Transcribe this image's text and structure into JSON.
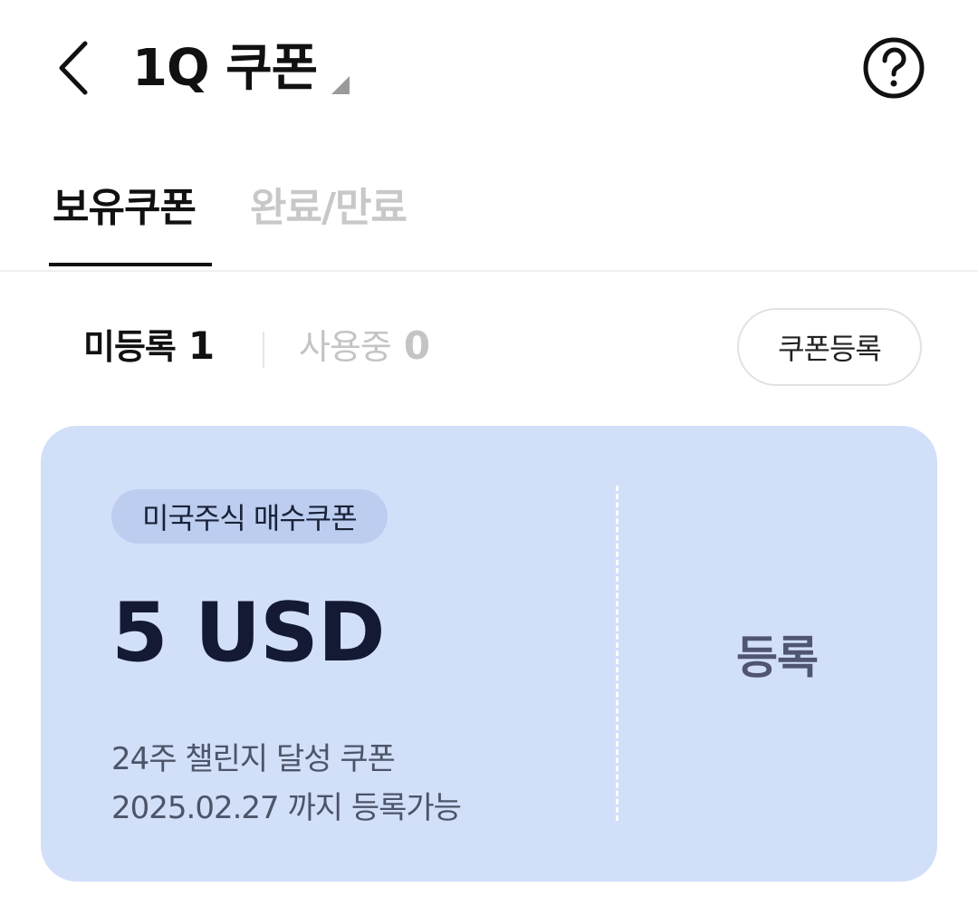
{
  "header": {
    "title": "1Q 쿠폰",
    "back_icon": "chevron-left-icon",
    "help_icon": "question-circle-icon"
  },
  "tabs": [
    {
      "label": "보유쿠폰",
      "active": true
    },
    {
      "label": "완료/만료",
      "active": false
    }
  ],
  "filter": {
    "unregistered_label": "미등록",
    "unregistered_count": "1",
    "in_use_label": "사용중",
    "in_use_count": "0",
    "register_button": "쿠폰등록"
  },
  "coupon": {
    "badge": "미국주식 매수쿠폰",
    "amount": "5 USD",
    "description": "24주 챌린지 달성 쿠폰",
    "expiry": "2025.02.27 까지 등록가능",
    "action": "등록",
    "background_color": "#d2dff9"
  }
}
